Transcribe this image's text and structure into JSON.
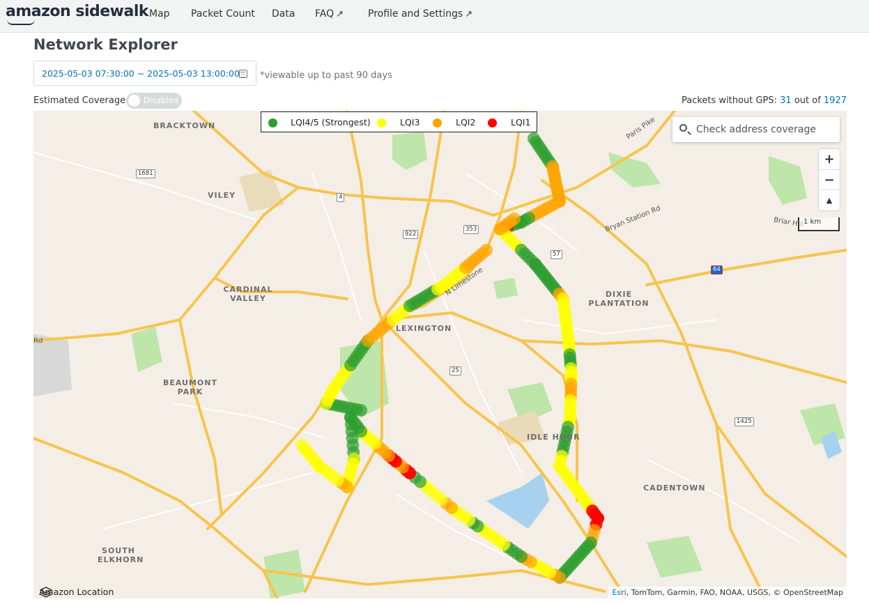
{
  "app": {
    "logo_text": "amazon sidewalk",
    "nav": [
      "Map",
      "Packet Count",
      "Data",
      "FAQ",
      "Profile and Settings"
    ],
    "external_icon": "external-link-icon"
  },
  "page": {
    "title": "Network Explorer",
    "date_range": "2025-05-03 07:30:00 ~ 2025-05-03 13:00:00",
    "date_note": "*viewable up to past 90 days",
    "coverage_label": "Estimated Coverage:",
    "coverage_toggle": "Disabled",
    "packets_prefix": "Packets without GPS:",
    "packets_missing": "31",
    "packets_mid": "out of",
    "packets_total": "1927"
  },
  "legend": [
    {
      "label": "LQI4/5 (Strongest)",
      "color": "#2e9e2e"
    },
    {
      "label": "LQI3",
      "color": "#ffff00"
    },
    {
      "label": "LQI2",
      "color": "#ffa500"
    },
    {
      "label": "LQI1",
      "color": "#ff0000"
    }
  ],
  "map": {
    "search_placeholder": "Check address coverage",
    "zoom_in": "+",
    "zoom_out": "−",
    "compass": "▲",
    "scale": "1 km",
    "attribution_link": "Esri",
    "attribution": ", TomTom, Garmin, FAO, NOAA, USGS, © OpenStreetMap",
    "brand": "Amazon Location",
    "places": [
      "BRACKTOWN",
      "VILEY",
      "CARDINAL VALLEY",
      "BEAUMONT PARK",
      "LEXINGTON",
      "DIXIE PLANTATION",
      "IDLE HOUR",
      "CADENTOWN",
      "SOUTH ELKHORN"
    ],
    "roads": [
      "Paris Pike",
      "Bryan Station Rd",
      "Briar Hill",
      "N Limestone",
      "Rd"
    ],
    "shields": [
      "1681",
      "4",
      "922",
      "353",
      "57",
      "64",
      "25",
      "1425"
    ]
  },
  "colors": {
    "accent": "#0073bb",
    "road": "#f7c44d",
    "park": "#b8e3a3",
    "water": "#a6d2f0",
    "lqi45": "#2e9e2e",
    "lqi3": "#ffff00",
    "lqi2": "#ffa500",
    "lqi1": "#ff0000"
  }
}
